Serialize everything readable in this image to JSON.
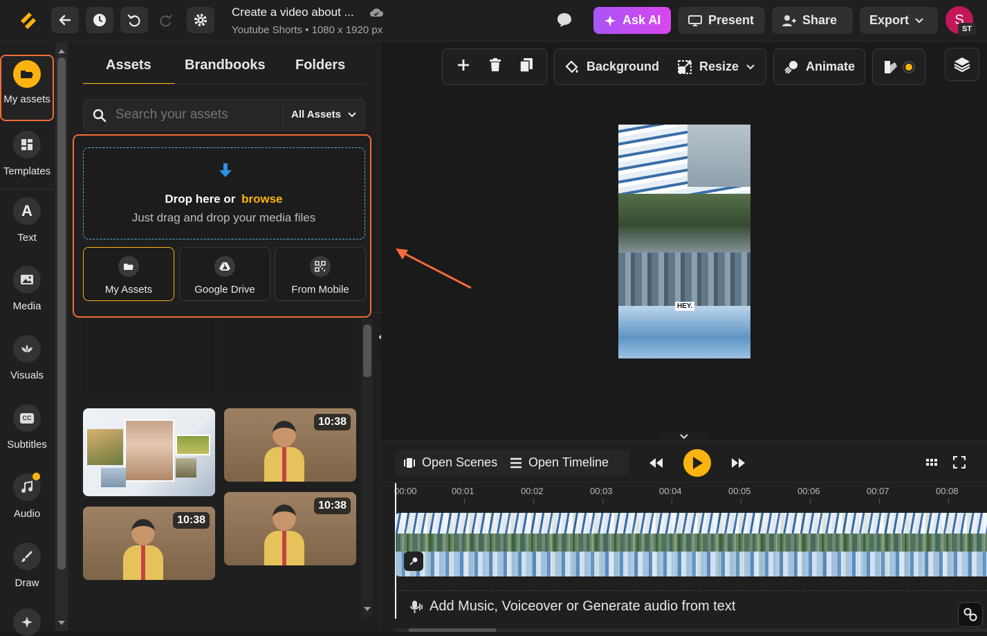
{
  "topbar": {
    "title": "Create a video about ...",
    "subtitle": "Youtube Shorts • 1080 x 1920 px",
    "ask_ai": "Ask AI",
    "present": "Present",
    "share": "Share",
    "export": "Export",
    "avatar_initial": "S",
    "avatar_badge": "ST"
  },
  "rail": {
    "items": [
      {
        "label": "My assets",
        "icon": "folder-icon"
      },
      {
        "label": "Templates",
        "icon": "templates-icon"
      },
      {
        "label": "Text",
        "icon": "text-icon"
      },
      {
        "label": "Media",
        "icon": "image-icon"
      },
      {
        "label": "Visuals",
        "icon": "visuals-icon"
      },
      {
        "label": "Subtitles",
        "icon": "cc-icon"
      },
      {
        "label": "Audio",
        "icon": "music-icon"
      },
      {
        "label": "Draw",
        "icon": "brush-icon"
      }
    ]
  },
  "panel": {
    "tabs": [
      "Assets",
      "Brandbooks",
      "Folders"
    ],
    "search_placeholder": "Search your assets",
    "filter": "All Assets",
    "drop_title": "Drop here or",
    "drop_browse": "browse",
    "drop_sub": "Just drag and drop your media files",
    "sources": [
      "My Assets",
      "Google Drive",
      "From Mobile"
    ],
    "thumbs": [
      {
        "time": ""
      },
      {
        "time": "10:38"
      },
      {
        "time": "10:38"
      },
      {
        "time": "10:38"
      }
    ]
  },
  "toolbar": {
    "background": "Background",
    "resize": "Resize",
    "animate": "Animate"
  },
  "canvas": {
    "caption": "HEY."
  },
  "timeline": {
    "open_scenes": "Open Scenes",
    "open_timeline": "Open Timeline",
    "ticks": [
      "00:00",
      "00:01",
      "00:02",
      "00:03",
      "00:04",
      "00:05",
      "00:06",
      "00:07",
      "00:08"
    ],
    "audio_prompt": "Add Music, Voiceover or Generate audio from text"
  },
  "colors": {
    "accent": "#fbb40f",
    "highlight": "#f26b3a",
    "ai_gradient_start": "#a855f7",
    "ai_gradient_end": "#d946ef",
    "avatar": "#c2185b",
    "dashed": "#5ab8e8"
  }
}
